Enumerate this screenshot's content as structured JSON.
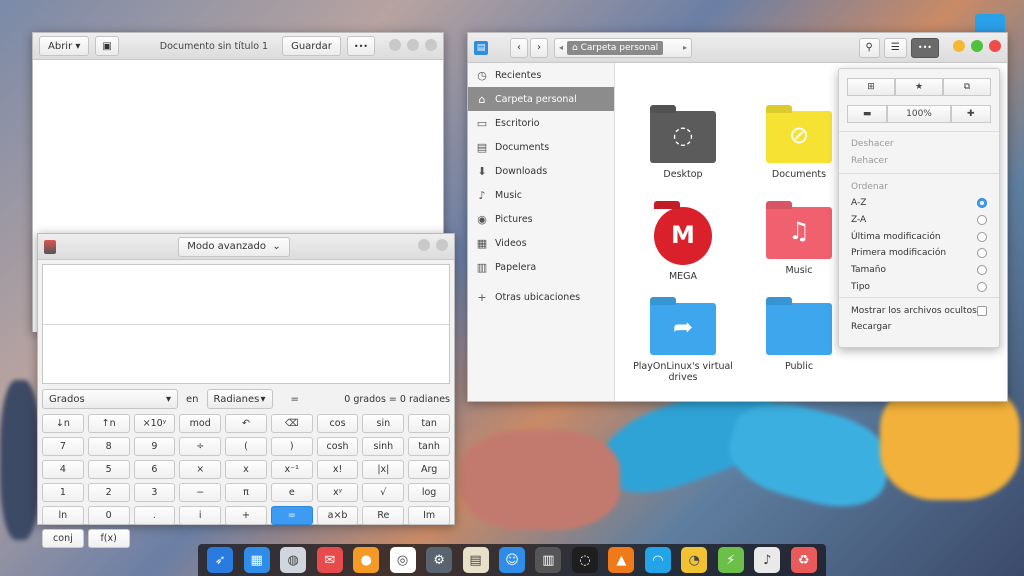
{
  "editor": {
    "open_label": "Abrir",
    "title": "Documento sin título 1",
    "save_label": "Guardar",
    "more_label": "•••"
  },
  "calculator": {
    "mode_label": "Modo avanzado",
    "unit_from": "Grados",
    "in_label": "en",
    "unit_to": "Radianes",
    "equals": "=",
    "conversion_result": "0 grados = 0 radianes",
    "keys": [
      "↓n",
      "↑n",
      "×10ʸ",
      "mod",
      "↶",
      "⌫",
      "cos",
      "sin",
      "tan",
      "7",
      "8",
      "9",
      "÷",
      "(",
      ")",
      "cosh",
      "sinh",
      "tanh",
      "4",
      "5",
      "6",
      "×",
      "x",
      "x⁻¹",
      "x!",
      "|x|",
      "Arg",
      "1",
      "2",
      "3",
      "−",
      "π",
      "e",
      "xʸ",
      "√",
      "log",
      "ln",
      "0",
      ".",
      "i",
      "+",
      "=",
      "a×b",
      "Re",
      "Im",
      "conj",
      "f(x)"
    ]
  },
  "files": {
    "breadcrumb": "Carpeta personal",
    "sidebar": [
      {
        "label": "Recientes",
        "icon": "clock-icon",
        "glyph": "◷"
      },
      {
        "label": "Carpeta personal",
        "icon": "home-icon",
        "glyph": "⌂"
      },
      {
        "label": "Escritorio",
        "icon": "desktop-icon",
        "glyph": "▭"
      },
      {
        "label": "Documents",
        "icon": "document-icon",
        "glyph": "▤"
      },
      {
        "label": "Downloads",
        "icon": "download-icon",
        "glyph": "⬇"
      },
      {
        "label": "Music",
        "icon": "music-icon",
        "glyph": "♪"
      },
      {
        "label": "Pictures",
        "icon": "camera-icon",
        "glyph": "◉"
      },
      {
        "label": "Videos",
        "icon": "film-icon",
        "glyph": "▦"
      },
      {
        "label": "Papelera",
        "icon": "trash-icon",
        "glyph": "▥"
      },
      {
        "label": "Otras ubicaciones",
        "icon": "plus-icon",
        "glyph": "+"
      }
    ],
    "items": [
      {
        "label": "Desktop",
        "color": "#5b5b5b",
        "glyph": "◌"
      },
      {
        "label": "Documents",
        "color": "#f6e233",
        "glyph": "⊘"
      },
      {
        "label": "MEGA",
        "color": "#d9202b",
        "glyph": "M"
      },
      {
        "label": "Music",
        "color": "#f0606e",
        "glyph": "♫"
      },
      {
        "label": "PlayOnLinux's virtual drives",
        "color": "#3da6ec",
        "glyph": "➦"
      },
      {
        "label": "Public",
        "color": "#3da6ec",
        "glyph": ""
      }
    ]
  },
  "popover": {
    "zoom": "100%",
    "undo": "Deshacer",
    "redo": "Rehacer",
    "sort_header": "Ordenar",
    "sort_options": [
      "A-Z",
      "Z-A",
      "Última modificación",
      "Primera modificación",
      "Tamaño",
      "Tipo"
    ],
    "sort_selected": 0,
    "show_hidden": "Mostrar los archivos ocultos",
    "reload": "Recargar"
  },
  "dock": [
    "rocket-icon",
    "multitasking-icon",
    "files-icon",
    "mail-icon",
    "orange-icon",
    "chrome-icon",
    "settings-icon",
    "notes-icon",
    "finder-icon",
    "calculator-icon",
    "dash-icon",
    "vlc-icon",
    "wifi-icon",
    "clock-icon",
    "android-icon",
    "music-icon",
    "trash-icon"
  ]
}
